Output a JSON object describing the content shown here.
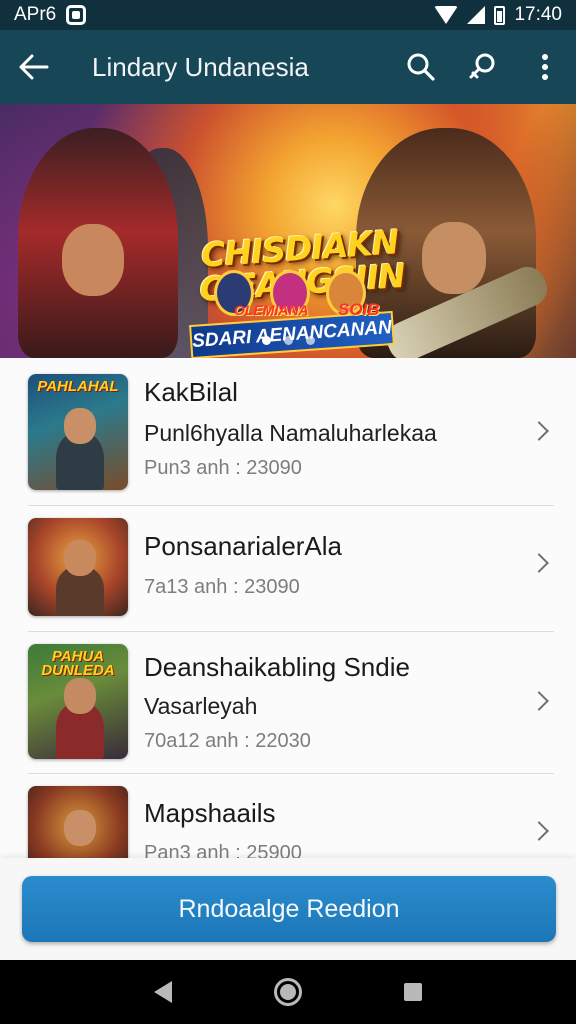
{
  "status_bar": {
    "left_text": "APr6",
    "time": "17:40"
  },
  "app_bar": {
    "title": "Lindary Undanesia"
  },
  "hero": {
    "title": "CHISDIAKN CIEANGSIIN",
    "subtitle": "SDARI AENANCANAN",
    "badge_text": "OLEMIANA",
    "badge_text_2": "SOIB",
    "slides": 3,
    "active_slide": 0
  },
  "games": [
    {
      "title": "KakBilal",
      "subtitle": "Punl6hyalla Namaluharlekaa",
      "meta": "Pun3 anh : 23090",
      "logo": "PAHLAHAL"
    },
    {
      "title": "PonsanarialerAla",
      "subtitle": "",
      "meta": "7a13 anh : 23090",
      "logo": ""
    },
    {
      "title": "Deanshaikabling Sndie",
      "subtitle": "Vasarleyah",
      "meta": "70a12 anh : 22030",
      "logo": "PAHUA DUNLEDA"
    },
    {
      "title": "Mapshaails",
      "subtitle": "",
      "meta": "Pan3 anh : 25900",
      "logo": ""
    }
  ],
  "primary_action": {
    "label": "Rndoaalge Reedion"
  },
  "colors": {
    "app_bar": "#174657",
    "status_bar": "#11303d",
    "accent": "#1c76b7"
  }
}
